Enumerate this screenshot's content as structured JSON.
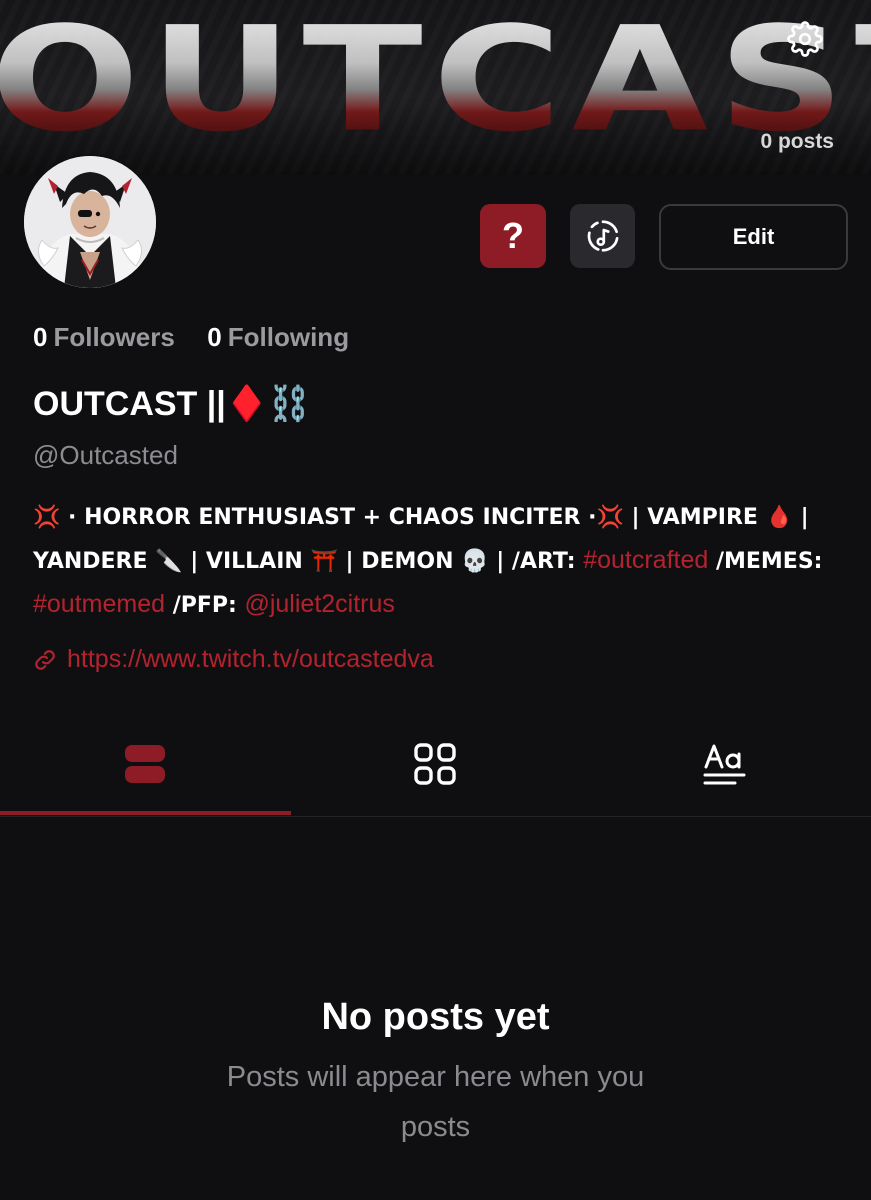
{
  "banner": {
    "text": "OUTCAST",
    "post_count": "0 posts"
  },
  "profile": {
    "followers_count": "0",
    "followers_label": "Followers",
    "following_count": "0",
    "following_label": "Following",
    "display_name": "OUTCAST ||♦️⛓️",
    "handle": "@Outcasted"
  },
  "actions": {
    "question_label": "?",
    "edit_label": "Edit"
  },
  "bio": {
    "line1": "💢 · HORROR ENTHUSIAST + CHAOS INCITER ·💢 | VAMPIRE 🩸 |",
    "line2_a": "YANDERE 🔪 | VILLAIN ⛩️ | DEMON 💀 | /ART: ",
    "tag_art": "#outcrafted",
    "line2_b": " /MEMES:",
    "tag_memes": "#outmemed",
    "line3_a": " /PFP: ",
    "mention_pfp": "@juliet2citrus"
  },
  "link": {
    "url": "https://www.twitch.tv/outcastedva"
  },
  "tabs": [
    {
      "icon": "list-icon",
      "active": true
    },
    {
      "icon": "grid-icon",
      "active": false
    },
    {
      "icon": "text-icon",
      "active": false
    }
  ],
  "empty_state": {
    "title": "No posts yet",
    "subtitle": "Posts will appear here when you posts"
  },
  "colors": {
    "accent": "#8d1c26",
    "link": "#b3232f",
    "background": "#0f0f11",
    "muted": "#8d8d91"
  }
}
